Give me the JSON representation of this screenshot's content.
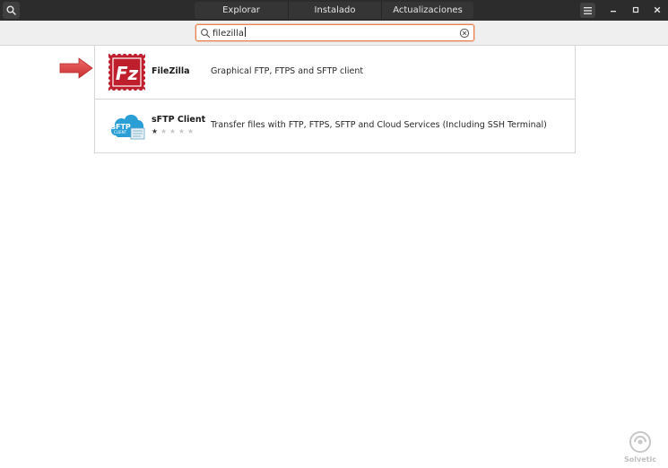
{
  "tabs": [
    {
      "label": "Explorar",
      "active": false
    },
    {
      "label": "Instalado",
      "active": false
    },
    {
      "label": "Actualizaciones",
      "active": false
    }
  ],
  "search": {
    "value": "filezilla"
  },
  "results": [
    {
      "name": "FileZilla",
      "description": "Graphical FTP, FTPS and SFTP client",
      "icon": "filezilla-icon"
    },
    {
      "name": "sFTP Client",
      "description": "Transfer files with FTP, FTPS, SFTP and Cloud Services (Including SSH Terminal)",
      "icon": "sftp-client-icon",
      "rating": 1,
      "rating_max": 5,
      "icon_text_top": "sFTP",
      "icon_text_bottom": "CLIENT"
    }
  ],
  "filezilla_icon_letter": "Fz",
  "watermark": {
    "text": "Solvetic"
  },
  "colors": {
    "titlebar": "#2c2c2c",
    "search_focus": "#e9824e",
    "filezilla_red": "#bf1e2d",
    "sftp_blue": "#2a9fd6",
    "arrow_red": "#e04343"
  }
}
